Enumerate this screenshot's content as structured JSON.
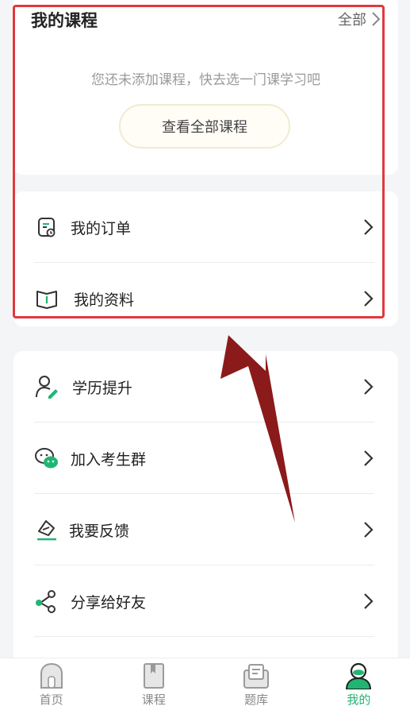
{
  "courses": {
    "title": "我的课程",
    "all_label": "全部",
    "empty_text": "您还未添加课程，快去选一门课学习吧",
    "view_all_button": "查看全部课程"
  },
  "menu_group_1": [
    {
      "label": "我的订单",
      "icon": "order-icon"
    },
    {
      "label": "我的资料",
      "icon": "book-icon"
    }
  ],
  "menu_group_2": [
    {
      "label": "学历提升",
      "icon": "user-edit-icon"
    },
    {
      "label": "加入考生群",
      "icon": "wechat-icon"
    },
    {
      "label": "我要反馈",
      "icon": "feedback-icon"
    },
    {
      "label": "分享给好友",
      "icon": "share-icon"
    }
  ],
  "tabbar": {
    "items": [
      {
        "label": "首页",
        "icon": "home-icon"
      },
      {
        "label": "课程",
        "icon": "course-icon"
      },
      {
        "label": "题库",
        "icon": "question-bank-icon"
      },
      {
        "label": "我的",
        "icon": "profile-icon"
      }
    ],
    "active_index": 3
  },
  "colors": {
    "accent": "#21b573",
    "highlight_box": "#e0393e",
    "arrow": "#8b1a1a"
  }
}
